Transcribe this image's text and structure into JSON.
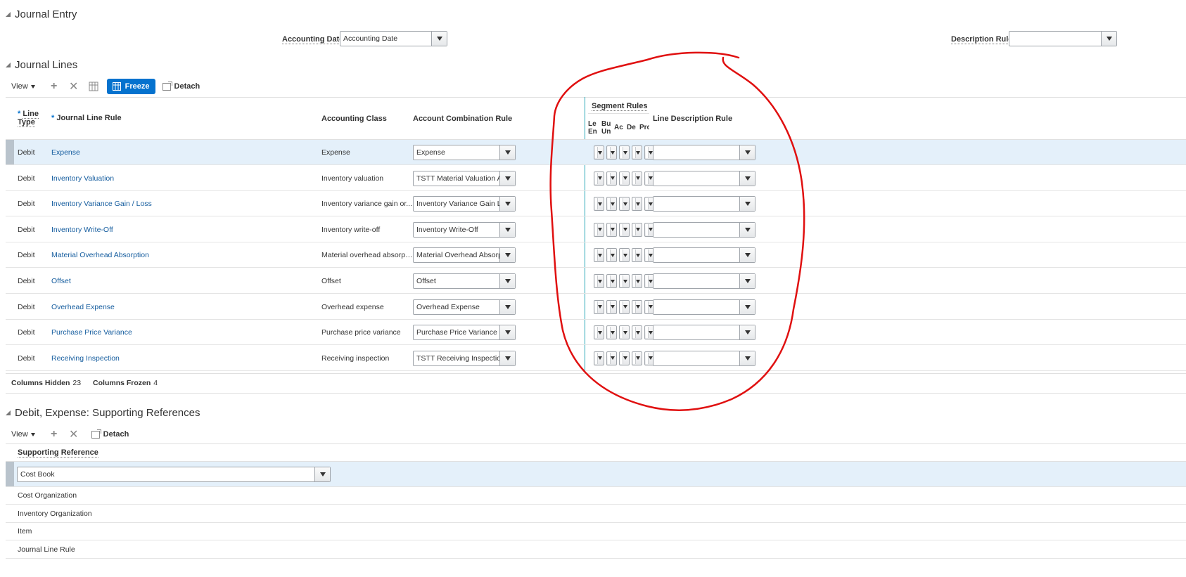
{
  "journal_entry": {
    "title": "Journal Entry",
    "accounting_date_label": "Accounting Date",
    "accounting_date_value": "Accounting Date",
    "description_rule_label": "Description Rule",
    "description_rule_value": ""
  },
  "journal_lines": {
    "title": "Journal Lines",
    "toolbar": {
      "view": "View",
      "freeze": "Freeze",
      "detach": "Detach"
    },
    "headers": {
      "line_type_1": "Line",
      "line_type_2": "Type",
      "journal_line_rule": "Journal Line Rule",
      "accounting_class": "Accounting Class",
      "account_combination_rule": "Account Combination Rule",
      "segment_rules": "Segment Rules",
      "seg_le_1": "Le",
      "seg_le_2": "En",
      "seg_bu_1": "Bu",
      "seg_bu_2": "Un",
      "seg_ac": "Ac",
      "seg_de": "De",
      "seg_pr": "Pro",
      "line_description_rule": "Line Description Rule"
    },
    "rows": [
      {
        "line_type": "Debit",
        "rule": "Expense",
        "class": "Expense",
        "combo": "Expense"
      },
      {
        "line_type": "Debit",
        "rule": "Inventory Valuation",
        "class": "Inventory valuation",
        "combo": "TSTT Material Valuation Ac"
      },
      {
        "line_type": "Debit",
        "rule": "Inventory Variance Gain / Loss",
        "class": "Inventory variance gain or...",
        "combo": "Inventory Variance Gain Lo"
      },
      {
        "line_type": "Debit",
        "rule": "Inventory Write-Off",
        "class": "Inventory write-off",
        "combo": "Inventory Write-Off"
      },
      {
        "line_type": "Debit",
        "rule": "Material Overhead Absorption",
        "class": "Material overhead absorpt...",
        "combo": "Material Overhead Absorpti"
      },
      {
        "line_type": "Debit",
        "rule": "Offset",
        "class": "Offset",
        "combo": "Offset"
      },
      {
        "line_type": "Debit",
        "rule": "Overhead Expense",
        "class": "Overhead expense",
        "combo": "Overhead Expense"
      },
      {
        "line_type": "Debit",
        "rule": "Purchase Price Variance",
        "class": "Purchase price variance",
        "combo": "Purchase Price Variance"
      },
      {
        "line_type": "Debit",
        "rule": "Receiving Inspection",
        "class": "Receiving inspection",
        "combo": "TSTT Receiving Inspection"
      }
    ],
    "footer": {
      "hidden_label": "Columns Hidden",
      "hidden_value": "23",
      "frozen_label": "Columns Frozen",
      "frozen_value": "4"
    }
  },
  "supporting_refs": {
    "title": "Debit, Expense: Supporting References",
    "toolbar": {
      "view": "View",
      "detach": "Detach"
    },
    "header": "Supporting Reference",
    "selected_value": "Cost Book",
    "items": [
      "Cost Organization",
      "Inventory Organization",
      "Item",
      "Journal Line Rule"
    ]
  },
  "colors": {
    "accent": "#0572ce",
    "link": "#145c9e",
    "selected_row": "#e4f0fa",
    "annotation": "#e01010"
  }
}
